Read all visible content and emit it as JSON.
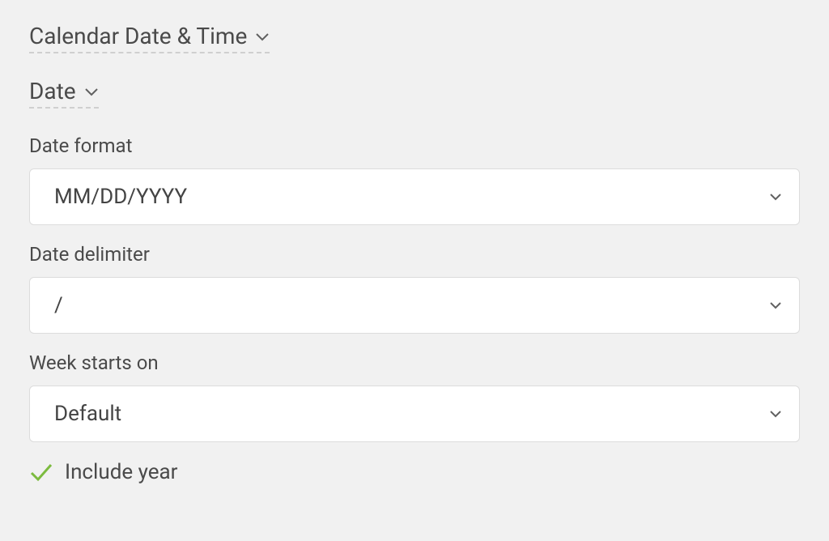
{
  "section": {
    "title": "Calendar Date & Time",
    "subtitle": "Date"
  },
  "fields": {
    "date_format": {
      "label": "Date format",
      "value": "MM/DD/YYYY"
    },
    "date_delimiter": {
      "label": "Date delimiter",
      "value": "/"
    },
    "week_starts": {
      "label": "Week starts on",
      "value": "Default"
    }
  },
  "checkbox": {
    "include_year": {
      "label": "Include year",
      "checked": true
    }
  }
}
